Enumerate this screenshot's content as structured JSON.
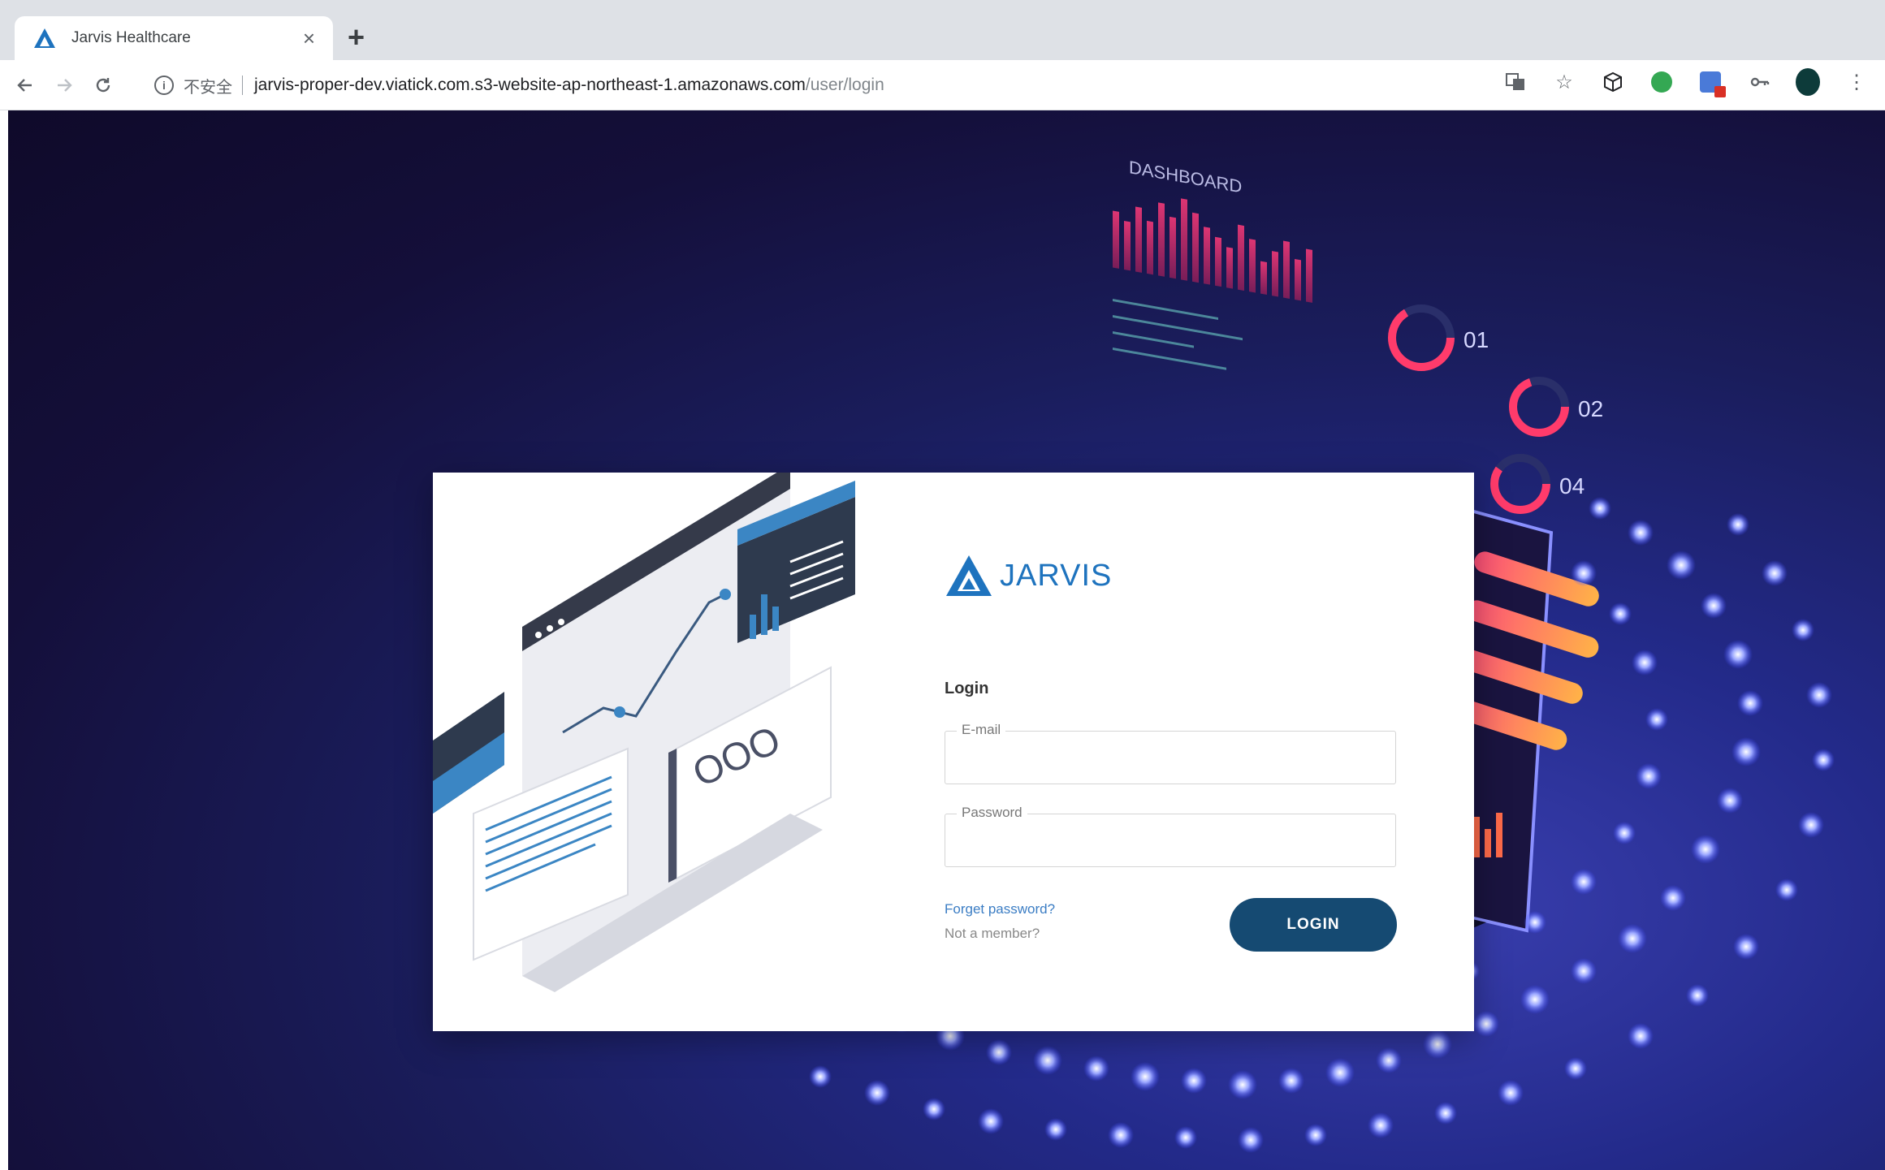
{
  "browser": {
    "tab_title": "Jarvis Healthcare",
    "tab_close": "×",
    "new_tab": "+",
    "security_label": "不安全",
    "url_host": "jarvis-proper-dev.viatick.com.s3-website-ap-northeast-1.amazonaws.com",
    "url_path": "/user/login"
  },
  "brand": {
    "name": "JARVIS",
    "color": "#1e73be"
  },
  "login": {
    "title": "Login",
    "email_label": "E-mail",
    "email_value": "",
    "password_label": "Password",
    "password_value": "",
    "forgot_link": "Forget password?",
    "member_link": "Not a member?",
    "button_label": "LOGIN",
    "button_color": "#154a72"
  },
  "background_dashboard": {
    "heading": "DASHBOARD",
    "items": [
      "01",
      "02",
      "04"
    ]
  },
  "illustration": {
    "circles_text": "OOO"
  }
}
